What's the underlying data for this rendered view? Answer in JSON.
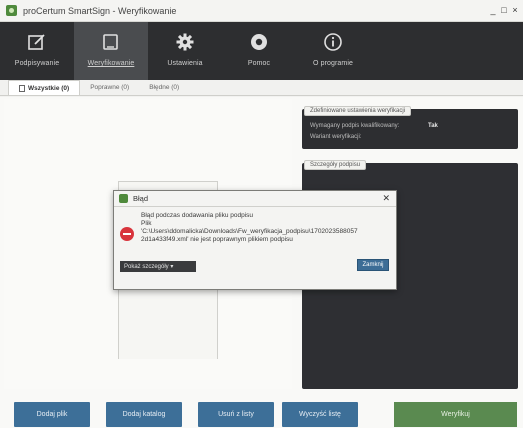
{
  "window": {
    "title": "proCertum SmartSign - Weryfikowanie",
    "controls": [
      "_",
      "□",
      "×"
    ]
  },
  "toolbar": {
    "items": [
      {
        "label": "Podpisywanie",
        "icon": "sign-icon"
      },
      {
        "label": "Weryfikowanie",
        "icon": "verify-icon",
        "active": true
      },
      {
        "label": "Ustawienia",
        "icon": "gear-icon"
      },
      {
        "label": "Pomoc",
        "icon": "help-icon"
      },
      {
        "label": "O programie",
        "icon": "info-icon"
      }
    ]
  },
  "tabs": [
    {
      "label": "Wszystkie (0)",
      "active": true
    },
    {
      "label": "Poprawne (0)"
    },
    {
      "label": "Błędne (0)"
    }
  ],
  "settings_panel": {
    "header": "Zdefiniowane ustawienia weryfikacji",
    "rows": [
      {
        "label": "Wymagany podpis kwalifikowany:",
        "value": "Tak"
      },
      {
        "label": "Wariant weryfikacji:",
        "value": ""
      }
    ]
  },
  "details_panel": {
    "header": "Szczegóły podpisu"
  },
  "bottom_buttons": {
    "add_file": "Dodaj plik",
    "add_folder": "Dodaj katalog",
    "remove": "Usuń z listy",
    "clear": "Wyczyść listę",
    "verify": "Weryfikuj"
  },
  "dialog": {
    "title": "Błąd",
    "message_line1": "Błąd podczas dodawania pliku podpisu",
    "message_line2": "Plik",
    "message_line3": "'C:\\Users\\ddomalicka\\Downloads\\Fw_weryfikacja_podpisu\\1702023588057",
    "message_line4": "2d1a433f49.xml' nie jest poprawnym plikiem podpisu",
    "details_toggle": "Pokaż szczegóły ▾",
    "ok": "Zamknij"
  },
  "colors": {
    "toolbar_bg": "#2d2e30",
    "panel_bg": "#2d2e31",
    "primary_button": "#3d6f98",
    "verify_button": "#5a8a50",
    "error": "#d8343c"
  }
}
